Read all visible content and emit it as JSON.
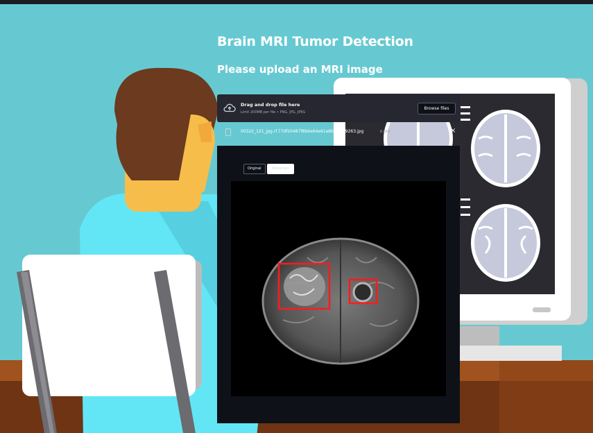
{
  "page": {
    "title": "Brain MRI Tumor Detection",
    "subtitle": "Please upload an MRI image"
  },
  "uploader": {
    "icon": "cloud-upload-icon",
    "main_text": "Drag and drop file here",
    "limit_text": "Limit 200MB per file • PNG, JPG, JPEG",
    "browse_label": "Browse files"
  },
  "uploaded_file": {
    "icon": "file-icon",
    "name": "00322_121_jpg.rf.77df20487f8b6e64e61a8bf93dc9263.jpg",
    "size": "6.8KB",
    "close_icon": "close-icon"
  },
  "result": {
    "tabs": [
      {
        "label": "Original",
        "selected": false
      },
      {
        "label": "Detection",
        "selected": true
      }
    ],
    "detections": 2,
    "box_color": "#ff1a1a"
  },
  "colors": {
    "background": "#66c9d1",
    "panel": "#0e1117",
    "uploader": "#262730"
  }
}
